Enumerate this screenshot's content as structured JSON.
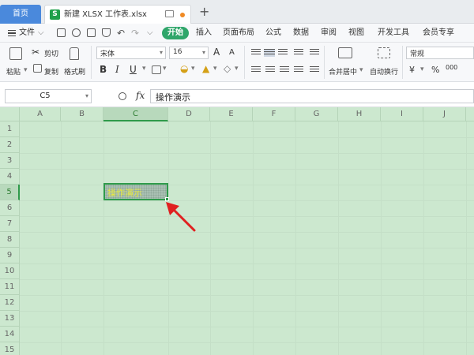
{
  "tabs": {
    "home_label": "首页",
    "doc_icon": "S",
    "doc_title": "新建 XLSX 工作表.xlsx",
    "add_label": "+"
  },
  "menu": {
    "file": "文件",
    "items": [
      "开始",
      "插入",
      "页面布局",
      "公式",
      "数据",
      "审阅",
      "视图",
      "开发工具",
      "会员专享"
    ],
    "active": "开始"
  },
  "ribbon": {
    "paste": "粘贴",
    "cut": "剪切",
    "copy": "复制",
    "format_painter": "格式刷",
    "font_name": "宋体",
    "font_size": "16",
    "merge_center": "合并居中",
    "wrap_text": "自动换行",
    "number_format": "常规",
    "currency_symbol": "¥",
    "percent_symbol": "%",
    "thousands": "000",
    "bold": "B",
    "italic": "I",
    "underline": "U",
    "font_grow": "A",
    "font_shrink": "A"
  },
  "formula_bar": {
    "cell_ref": "C5",
    "fx": "fx",
    "content": "操作演示"
  },
  "sheet": {
    "columns": [
      "A",
      "B",
      "C",
      "D",
      "E",
      "F",
      "G",
      "H",
      "I",
      "J"
    ],
    "rows": [
      "1",
      "2",
      "3",
      "4",
      "5",
      "6",
      "7",
      "8",
      "9",
      "10",
      "11",
      "12",
      "13",
      "14",
      "15"
    ],
    "selected_column": "C",
    "selected_row": "5",
    "active_cell_text": "操作演示"
  },
  "colors": {
    "grid_background": "#cce8cf",
    "accent_green": "#2fa66a",
    "home_tab": "#4a89dc",
    "arrow_red": "#e02020"
  }
}
